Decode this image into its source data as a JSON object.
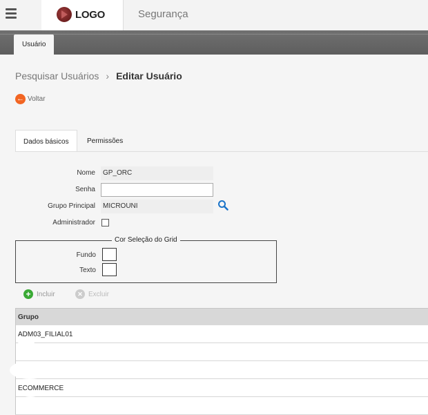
{
  "header": {
    "logo_text": "LOGO",
    "app_title": "Segurança"
  },
  "main_tab": {
    "label": "Usuário"
  },
  "breadcrumb": {
    "parent": "Pesquisar Usuários",
    "separator": "›",
    "current": "Editar Usuário"
  },
  "back": {
    "label": "Voltar",
    "icon": "arrow-left-icon",
    "color": "#f26522"
  },
  "subtabs": [
    {
      "label": "Dados básicos",
      "active": true
    },
    {
      "label": "Permissões",
      "active": false
    }
  ],
  "form": {
    "nome": {
      "label": "Nome",
      "value": "GP_ORC"
    },
    "senha": {
      "label": "Senha",
      "value": ""
    },
    "grupo_principal": {
      "label": "Grupo Principal",
      "value": "MICROUNI"
    },
    "administrador": {
      "label": "Administrador",
      "checked": false
    }
  },
  "grid_color": {
    "legend": "Cor Seleção do Grid",
    "fundo": "Fundo",
    "texto": "Texto"
  },
  "actions": {
    "incluir": {
      "label": "Incluir",
      "color": "#3aaa35",
      "enabled": true
    },
    "excluir": {
      "label": "Excluir",
      "color": "#cccccc",
      "enabled": false
    }
  },
  "table": {
    "header": "Grupo",
    "rows": [
      "ADM03_FILIAL01",
      "",
      "",
      "ECOMMERCE",
      ""
    ]
  }
}
